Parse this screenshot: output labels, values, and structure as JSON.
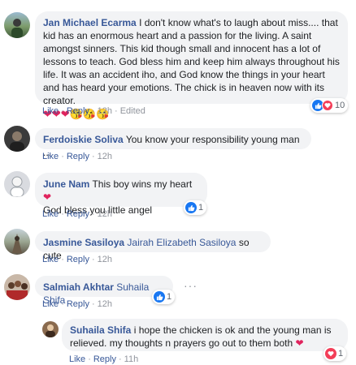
{
  "c1": {
    "author": "Jan Michael Ecarma",
    "text": " I don't know what's to laugh about miss.... that kid has an enormous heart and a passion for the living. A saint amongst sinners. This kid though small and innocent has a lot of lessons to teach. God bless him and keep him always throughout his life. It was an accident iho, and God know the things in your heart and has heard your emotions. The chick is in heaven now with its creator.",
    "emoji": "❤❤❤😘😘😘",
    "like": "Like",
    "reply": "Reply",
    "time": "12h",
    "edited": "Edited",
    "reaction_count": "10"
  },
  "c2": {
    "author": "Ferdoiskie Soliva",
    "text": " You know your responsibility young man ...",
    "like": "Like",
    "reply": "Reply",
    "time": "12h"
  },
  "c3": {
    "author": "June Nam",
    "text1": " This boy wins my heart",
    "heart": "❤",
    "text2": "God bless you little angel",
    "like": "Like",
    "reply": "Reply",
    "time": "12h",
    "reaction_count": "1"
  },
  "c4": {
    "author": "Jasmine Sasiloya",
    "tag": " Jairah Elizabeth Sasiloya",
    "text": " so cute",
    "like": "Like",
    "reply": "Reply",
    "time": "12h"
  },
  "c5": {
    "author": "Salmiah Akhtar",
    "tag": " Suhaila Shifa",
    "more": "···",
    "like": "Like",
    "reply": "Reply",
    "time": "12h",
    "reaction_count": "1"
  },
  "c6": {
    "author": "Suhaila Shifa",
    "text": " i hope the chicken is ok and the young man is relieved. my thoughts n prayers go out to them both ",
    "heart": "❤",
    "like": "Like",
    "reply": "Reply",
    "time": "11h",
    "reaction_count": "1"
  },
  "colors": {
    "link": "#385898",
    "bubble": "#f2f3f5",
    "like_blue": "#1877f2",
    "love_red": "#f33e58"
  }
}
